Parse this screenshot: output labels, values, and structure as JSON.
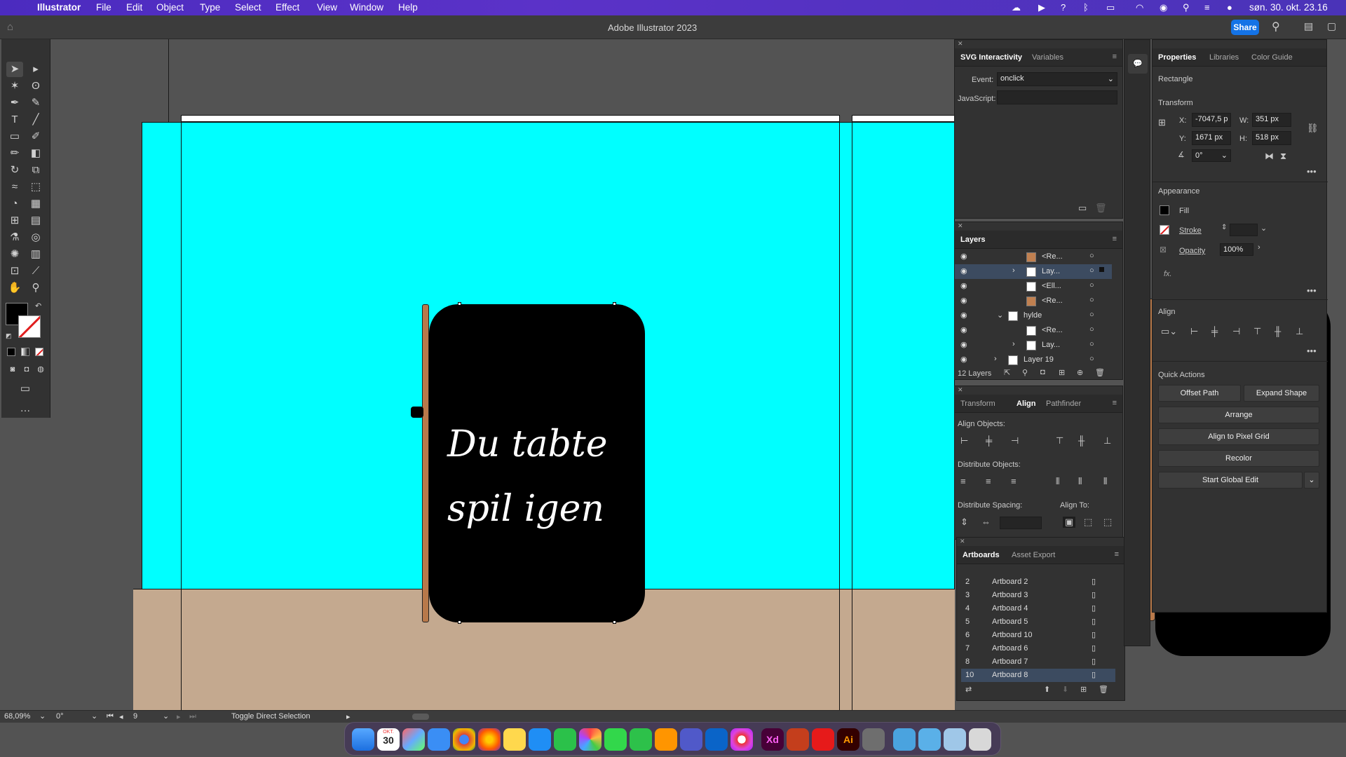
{
  "menubar": {
    "app_name": "Illustrator",
    "items": [
      "File",
      "Edit",
      "Object",
      "Type",
      "Select",
      "Effect",
      "View",
      "Window",
      "Help"
    ],
    "datetime": "søn. 30. okt. 23.16"
  },
  "titlebar": {
    "title": "Adobe Illustrator 2023",
    "share_label": "Share"
  },
  "artwork": {
    "line1": "Du tabte",
    "line2": "spil igen"
  },
  "svg_panel": {
    "tabs": [
      "SVG Interactivity",
      "Variables"
    ],
    "event_label": "Event:",
    "event_value": "onclick",
    "javascript_label": "JavaScript:"
  },
  "layers_panel": {
    "tab": "Layers",
    "rows": [
      {
        "name": "<Re..."
      },
      {
        "name": "Lay..."
      },
      {
        "name": "<Ell..."
      },
      {
        "name": "<Re..."
      },
      {
        "name": "hylde"
      },
      {
        "name": "<Re..."
      },
      {
        "name": "Lay..."
      },
      {
        "name": "Layer 19"
      }
    ],
    "count": "12 Layers"
  },
  "align_panel": {
    "tabs": [
      "Transform",
      "Align",
      "Pathfinder"
    ],
    "align_objects": "Align Objects:",
    "distribute_objects": "Distribute Objects:",
    "distribute_spacing": "Distribute Spacing:",
    "align_to": "Align To:"
  },
  "artboards_panel": {
    "tabs": [
      "Artboards",
      "Asset Export"
    ],
    "rows": [
      {
        "num": "2",
        "name": "Artboard 2"
      },
      {
        "num": "3",
        "name": "Artboard 3"
      },
      {
        "num": "4",
        "name": "Artboard 4"
      },
      {
        "num": "5",
        "name": "Artboard 5"
      },
      {
        "num": "6",
        "name": "Artboard 10"
      },
      {
        "num": "7",
        "name": "Artboard 6"
      },
      {
        "num": "8",
        "name": "Artboard 7"
      },
      {
        "num": "10",
        "name": "Artboard 8"
      }
    ]
  },
  "properties_panel": {
    "tabs": [
      "Properties",
      "Libraries",
      "Color Guide"
    ],
    "object_type": "Rectangle",
    "transform_label": "Transform",
    "x_label": "X:",
    "x_value": "-7047,5 p",
    "y_label": "Y:",
    "y_value": "1671 px",
    "w_label": "W:",
    "w_value": "351 px",
    "h_label": "H:",
    "h_value": "518 px",
    "angle_value": "0°",
    "appearance_label": "Appearance",
    "fill_label": "Fill",
    "stroke_label": "Stroke",
    "opacity_label": "Opacity",
    "opacity_value": "100%",
    "fx_label": "fx.",
    "align_label": "Align",
    "quick_actions_label": "Quick Actions",
    "offset_path": "Offset Path",
    "expand_shape": "Expand Shape",
    "arrange": "Arrange",
    "align_pixel_grid": "Align to Pixel Grid",
    "recolor": "Recolor",
    "start_global_edit": "Start Global Edit"
  },
  "statusbar": {
    "zoom": "68,09%",
    "rotation": "0°",
    "artboard_num": "9",
    "status_text": "Toggle Direct Selection"
  },
  "colors": {
    "cyan": "#00ffff",
    "floor": "#c4a98f",
    "brown": "#b8794a",
    "menubar": "#4b2bbf",
    "accent": "#1473e6"
  },
  "dock": {
    "calendar_day": "30",
    "calendar_month": "OKT."
  }
}
